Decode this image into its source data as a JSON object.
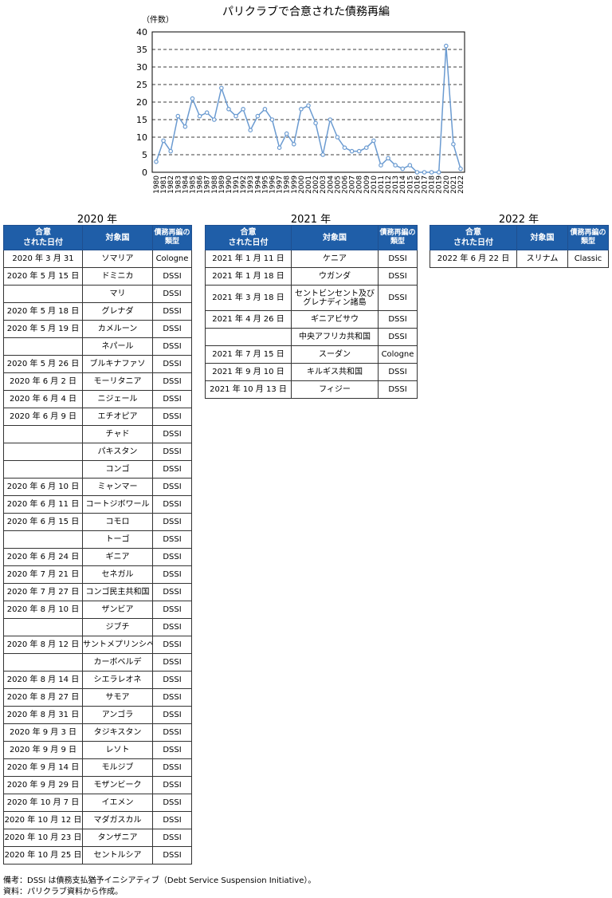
{
  "chart_data": {
    "type": "line",
    "title": "パリクラブで合意された債務再編",
    "ylabel": "（件数）",
    "ylim": [
      0,
      40
    ],
    "yticks": [
      0,
      5,
      10,
      15,
      20,
      25,
      30,
      35,
      40
    ],
    "grid": "horizontal dashed",
    "x": [
      "1980",
      "1981",
      "1982",
      "1983",
      "1984",
      "1985",
      "1986",
      "1987",
      "1988",
      "1989",
      "1990",
      "1991",
      "1992",
      "1993",
      "1994",
      "1995",
      "1996",
      "1997",
      "1998",
      "1999",
      "2000",
      "2001",
      "2002",
      "2003",
      "2004",
      "2005",
      "2006",
      "2007",
      "2008",
      "2009",
      "2010",
      "2011",
      "2012",
      "2013",
      "2014",
      "2015",
      "2016",
      "2017",
      "2018",
      "2019",
      "2020",
      "2021",
      "2022"
    ],
    "values": [
      3,
      9,
      6,
      16,
      13,
      21,
      16,
      17,
      15,
      24,
      18,
      16,
      18,
      12,
      16,
      18,
      15,
      7,
      11,
      8,
      18,
      19,
      14,
      5,
      15,
      10,
      7,
      6,
      6,
      7,
      9,
      2,
      4,
      2,
      1,
      2,
      0,
      0,
      0,
      0,
      36,
      8,
      1
    ],
    "color": "#6b9bd1"
  },
  "tables": {
    "header": {
      "date": "合意\nされた日付",
      "country": "対象国",
      "type": "債務再編の\n類型"
    },
    "t2020": {
      "title": "2020 年",
      "rows": [
        [
          "2020 年 3 月 31",
          "ソマリア",
          "Cologne"
        ],
        [
          "2020 年 5 月 15 日",
          "ドミニカ",
          "DSSI"
        ],
        [
          "",
          "マリ",
          "DSSI"
        ],
        [
          "2020 年 5 月 18 日",
          "グレナダ",
          "DSSI"
        ],
        [
          "2020 年 5 月 19 日",
          "カメルーン",
          "DSSI"
        ],
        [
          "",
          "ネパール",
          "DSSI"
        ],
        [
          "2020 年 5 月 26 日",
          "ブルキナファソ",
          "DSSI"
        ],
        [
          "2020 年 6 月 2 日",
          "モーリタニア",
          "DSSI"
        ],
        [
          "2020 年 6 月 4 日",
          "ニジェール",
          "DSSI"
        ],
        [
          "2020 年 6 月 9 日",
          "エチオピア",
          "DSSI"
        ],
        [
          "",
          "チャド",
          "DSSI"
        ],
        [
          "",
          "パキスタン",
          "DSSI"
        ],
        [
          "",
          "コンゴ",
          "DSSI"
        ],
        [
          "2020 年 6 月 10 日",
          "ミャンマー",
          "DSSI"
        ],
        [
          "2020 年 6 月 11 日",
          "コートジボワール",
          "DSSI"
        ],
        [
          "2020 年 6 月 15 日",
          "コモロ",
          "DSSI"
        ],
        [
          "",
          "トーゴ",
          "DSSI"
        ],
        [
          "2020 年 6 月 24 日",
          "ギニア",
          "DSSI"
        ],
        [
          "2020 年 7 月 21 日",
          "セネガル",
          "DSSI"
        ],
        [
          "2020 年 7 月 27 日",
          "コンゴ民主共和国",
          "DSSI"
        ],
        [
          "2020 年 8 月 10 日",
          "ザンビア",
          "DSSI"
        ],
        [
          "",
          "ジブチ",
          "DSSI"
        ],
        [
          "2020 年 8 月 12 日",
          "サントメプリンシペ",
          "DSSI"
        ],
        [
          "",
          "カーボベルデ",
          "DSSI"
        ],
        [
          "2020 年 8 月 14 日",
          "シエラレオネ",
          "DSSI"
        ],
        [
          "2020 年 8 月 27 日",
          "サモア",
          "DSSI"
        ],
        [
          "2020 年 8 月 31 日",
          "アンゴラ",
          "DSSI"
        ],
        [
          "2020 年 9 月 3 日",
          "タジキスタン",
          "DSSI"
        ],
        [
          "2020 年 9 月 9 日",
          "レソト",
          "DSSI"
        ],
        [
          "2020 年 9 月 14 日",
          "モルジブ",
          "DSSI"
        ],
        [
          "2020 年 9 月 29 日",
          "モザンビーク",
          "DSSI"
        ],
        [
          "2020 年 10 月 7 日",
          "イエメン",
          "DSSI"
        ],
        [
          "2020 年 10 月 12 日",
          "マダガスカル",
          "DSSI"
        ],
        [
          "2020 年 10 月 23 日",
          "タンザニア",
          "DSSI"
        ],
        [
          "2020 年 10 月 25 日",
          "セントルシア",
          "DSSI"
        ]
      ]
    },
    "t2021": {
      "title": "2021 年",
      "rows": [
        [
          "2021 年 1 月 11 日",
          "ケニア",
          "DSSI"
        ],
        [
          "2021 年 1 月 18 日",
          "ウガンダ",
          "DSSI"
        ],
        [
          "2021 年 3 月 18 日",
          "セントビンセント及び\nグレナディン諸島",
          "DSSI"
        ],
        [
          "2021 年 4 月 26 日",
          "ギニアビサウ",
          "DSSI"
        ],
        [
          "",
          "中央アフリカ共和国",
          "DSSI"
        ],
        [
          "2021 年 7 月 15 日",
          "スーダン",
          "Cologne"
        ],
        [
          "2021 年 9 月 10 日",
          "キルギス共和国",
          "DSSI"
        ],
        [
          "2021 年 10 月 13 日",
          "フィジー",
          "DSSI"
        ]
      ]
    },
    "t2022": {
      "title": "2022 年",
      "rows": [
        [
          "2022 年 6 月 22 日",
          "スリナム",
          "Classic"
        ]
      ]
    }
  },
  "notes": {
    "line1": "備考：DSSI は債務支払猶予イニシアティブ（Debt Service Suspension Initiative）。",
    "line2": "資料：パリクラブ資料から作成。"
  }
}
